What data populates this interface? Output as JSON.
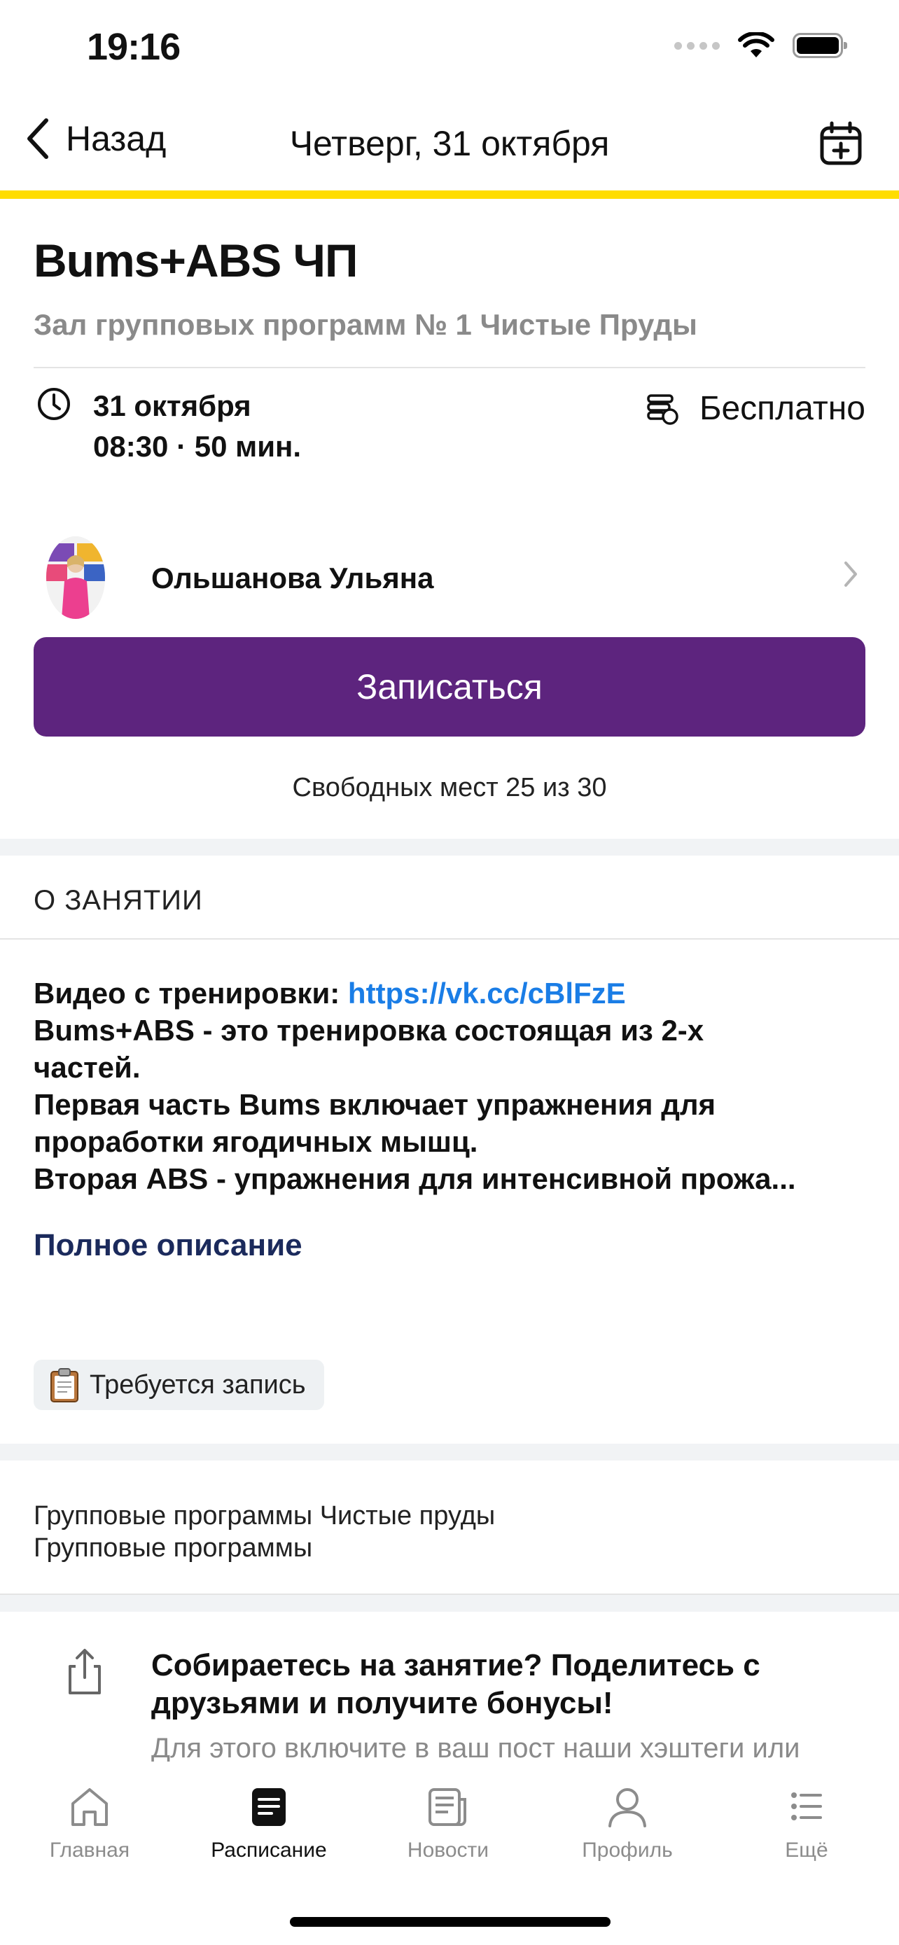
{
  "status_bar": {
    "time": "19:16"
  },
  "nav": {
    "back_label": "Назад",
    "title": "Четверг, 31 октября"
  },
  "accent_color": "#FFDD00",
  "class": {
    "title": "Bums+ABS ЧП",
    "hall": "Зал групповых программ № 1 Чистые Пруды",
    "date": "31 октября",
    "time": "08:30 · 50 мин.",
    "price": "Бесплатно"
  },
  "trainer": {
    "name": "Ольшанова Ульяна"
  },
  "enroll": {
    "label": "Записаться",
    "color": "#5D247E",
    "places": "Свободных мест 25 из 30"
  },
  "about": {
    "heading": "О ЗАНЯТИИ",
    "video_prefix": "Видео с тренировки: ",
    "video_link": "https://vk.cc/cBlFzE",
    "lines": [
      "Bums+ABS - это тренировка состоящая из 2-х",
      "частей.",
      "Первая часть Bums включает упражнения для",
      "проработки ягодичных мышц.",
      "Вторая ABS - упражнения для интенсивной прожа..."
    ],
    "full_description": "Полное описание",
    "chip": "Требуется запись"
  },
  "groups": [
    "Групповые программы Чистые пруды",
    "Групповые программы"
  ],
  "share": {
    "title": "Собираетесь на занятие? Поделитесь с друзьями и получите бонусы!",
    "subtitle": "Для этого включите в ваш пост наши хэштеги или"
  },
  "tabs": [
    {
      "label": "Главная",
      "icon": "home-icon"
    },
    {
      "label": "Расписание",
      "icon": "schedule-icon",
      "active": true
    },
    {
      "label": "Новости",
      "icon": "news-icon"
    },
    {
      "label": "Профиль",
      "icon": "profile-icon"
    },
    {
      "label": "Ещё",
      "icon": "more-icon"
    }
  ]
}
